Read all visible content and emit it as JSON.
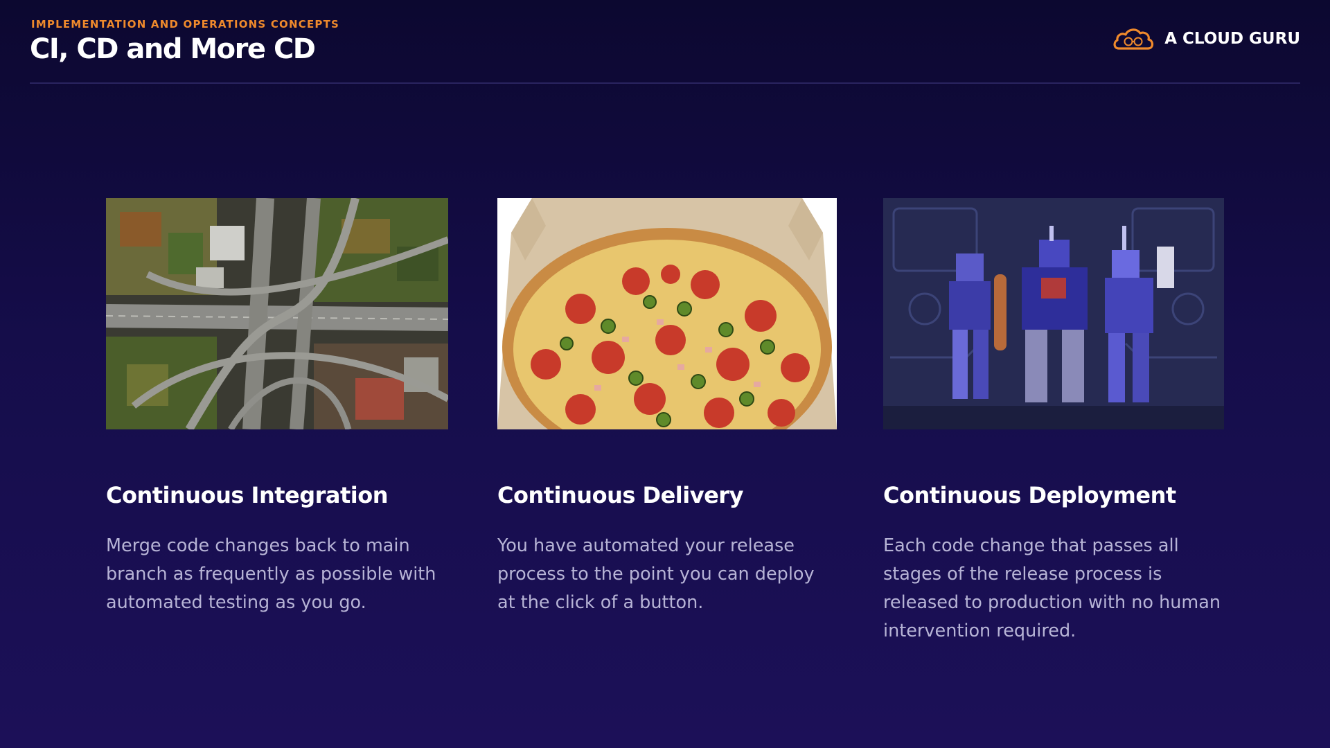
{
  "header": {
    "eyebrow": "IMPLEMENTATION AND OPERATIONS CONCEPTS",
    "title": "CI, CD and More CD",
    "brand_name": "A CLOUD GURU",
    "brand_logo_icon": "cloud-logo-icon"
  },
  "colors": {
    "background_top": "#0c0830",
    "background_bottom": "#1c1058",
    "eyebrow": "#f08a2c",
    "body_text": "#b7b4d6",
    "heading_text": "#ffffff"
  },
  "cards": [
    {
      "image_subject": "aerial highway interchange",
      "heading": "Continuous Integration",
      "body": "Merge code changes back to main branch as frequently as possible with automated testing as you go."
    },
    {
      "image_subject": "pepperoni jalapeño pizza in box",
      "heading": "Continuous Delivery",
      "body": "You have automated your release process to the point you can deploy at the click of a button."
    },
    {
      "image_subject": "robot action figures",
      "heading": "Continuous Deployment",
      "body": "Each code change that passes all stages of the release process is released to production with no human intervention required."
    }
  ]
}
